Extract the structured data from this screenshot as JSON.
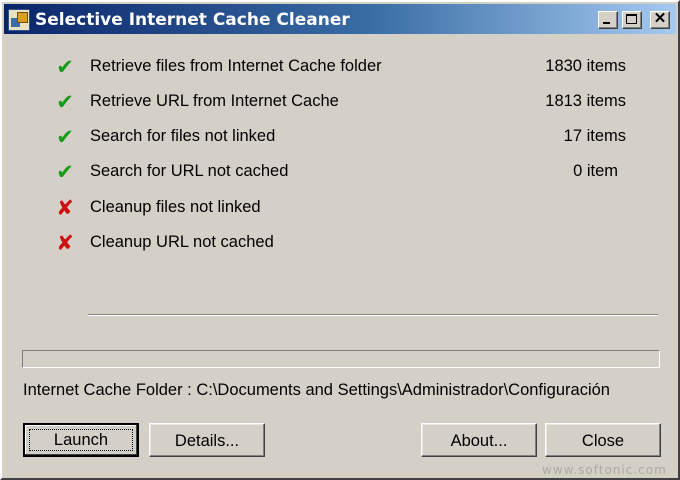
{
  "window": {
    "title": "Selective Internet Cache Cleaner",
    "controls": {
      "minimize": "_",
      "maximize": "□",
      "close": "✕"
    }
  },
  "tasks": [
    {
      "status": "success",
      "icon": "check-icon",
      "glyph": "✔",
      "label": "Retrieve files from Internet Cache folder",
      "count": "1830 items"
    },
    {
      "status": "success",
      "icon": "check-icon",
      "glyph": "✔",
      "label": "Retrieve URL from Internet Cache",
      "count": "1813 items"
    },
    {
      "status": "success",
      "icon": "check-icon",
      "glyph": "✔",
      "label": "Search for files not linked",
      "count": "17 items"
    },
    {
      "status": "success",
      "icon": "check-icon",
      "glyph": "✔",
      "label": "Search for URL not cached",
      "count": "0 item"
    },
    {
      "status": "failed",
      "icon": "cross-icon",
      "glyph": "✘",
      "label": "Cleanup files not linked",
      "count": ""
    },
    {
      "status": "failed",
      "icon": "cross-icon",
      "glyph": "✘",
      "label": "Cleanup URL not cached",
      "count": ""
    }
  ],
  "progress": {
    "fraction": 0.0
  },
  "folder": {
    "text": "Internet Cache Folder : C:\\Documents and Settings\\Administrador\\Configuración"
  },
  "buttons": {
    "launch": "Launch",
    "details": "Details...",
    "about": "About...",
    "close": "Close"
  },
  "watermark": "www.softonic.com",
  "colors": {
    "titlebar_start": "#0a246a",
    "titlebar_end": "#a6caf0",
    "success": "#1a9a1a",
    "failed": "#d01010",
    "face": "#d4d0c8"
  }
}
